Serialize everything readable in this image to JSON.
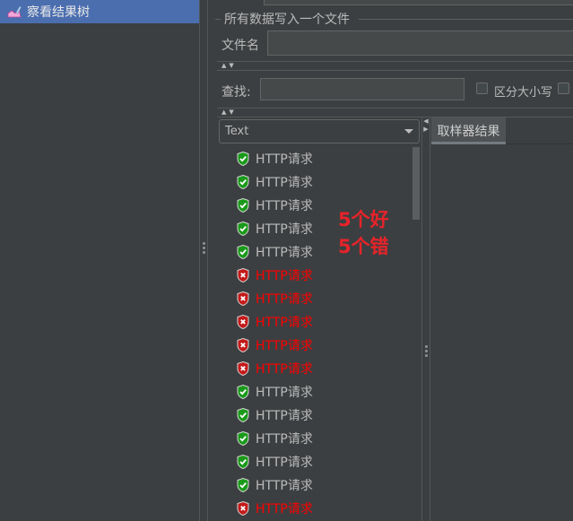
{
  "tree": {
    "selected_item": {
      "label": "察看结果树",
      "icon": "results-tree-icon"
    }
  },
  "file_group": {
    "title": "所有数据写入一个文件",
    "filename_label": "文件名",
    "filename_value": ""
  },
  "search": {
    "label": "查找:",
    "value": "",
    "case_sensitive_label": "区分大小写",
    "case_sensitive_checked": false,
    "regex_checked": false
  },
  "renderer_select": {
    "value": "Text"
  },
  "results_tab": {
    "label": "取样器结果"
  },
  "annotation": {
    "line1": "5个好",
    "line2": "5个错"
  },
  "colors": {
    "selection": "#4b6eaf",
    "error_text": "#ff0000",
    "ok_text": "#bbbbbb",
    "annotation": "#e8232a"
  },
  "results": [
    {
      "label": "HTTP请求",
      "status": "success"
    },
    {
      "label": "HTTP请求",
      "status": "success"
    },
    {
      "label": "HTTP请求",
      "status": "success"
    },
    {
      "label": "HTTP请求",
      "status": "success"
    },
    {
      "label": "HTTP请求",
      "status": "success"
    },
    {
      "label": "HTTP请求",
      "status": "error"
    },
    {
      "label": "HTTP请求",
      "status": "error"
    },
    {
      "label": "HTTP请求",
      "status": "error"
    },
    {
      "label": "HTTP请求",
      "status": "error"
    },
    {
      "label": "HTTP请求",
      "status": "error"
    },
    {
      "label": "HTTP请求",
      "status": "success"
    },
    {
      "label": "HTTP请求",
      "status": "success"
    },
    {
      "label": "HTTP请求",
      "status": "success"
    },
    {
      "label": "HTTP请求",
      "status": "success"
    },
    {
      "label": "HTTP请求",
      "status": "success"
    },
    {
      "label": "HTTP请求",
      "status": "error"
    }
  ]
}
